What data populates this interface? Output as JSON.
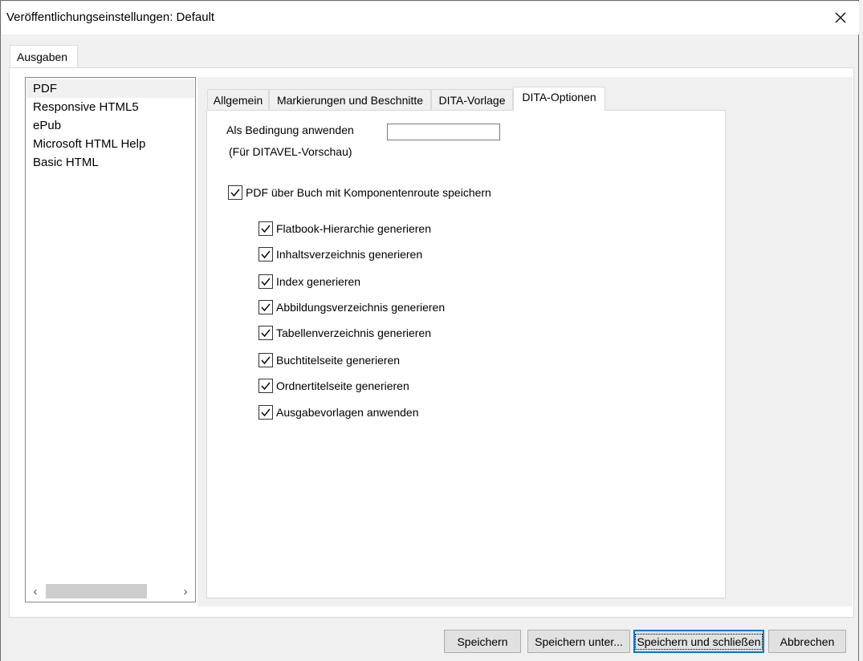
{
  "window": {
    "title": "Veröffentlichungseinstellungen: Default"
  },
  "outer_tab": {
    "label": "Ausgaben"
  },
  "outputs": {
    "items": [
      {
        "label": "PDF",
        "selected": true
      },
      {
        "label": "Responsive HTML5",
        "selected": false
      },
      {
        "label": "ePub",
        "selected": false
      },
      {
        "label": "Microsoft HTML Help",
        "selected": false
      },
      {
        "label": "Basic HTML",
        "selected": false
      }
    ],
    "scroll_left": "‹",
    "scroll_right": "›"
  },
  "tabs": [
    {
      "label": "Allgemein",
      "active": false
    },
    {
      "label": "Markierungen und Beschnitte",
      "active": false
    },
    {
      "label": "DITA-Vorlage",
      "active": false
    },
    {
      "label": "DITA-Optionen",
      "active": true
    }
  ],
  "dita_options": {
    "condition_label": "Als Bedingung anwenden",
    "condition_sublabel": "(Für DITAVEL-Vorschau)",
    "condition_value": "",
    "main_checkbox": {
      "label": "PDF über Buch mit Komponentenroute speichern",
      "checked": true
    },
    "sub_checkboxes": [
      {
        "label": "Flatbook-Hierarchie generieren",
        "checked": true
      },
      {
        "label": "Inhaltsverzeichnis generieren",
        "checked": true
      },
      {
        "label": "Index generieren",
        "checked": true
      },
      {
        "label": "Abbildungsverzeichnis generieren",
        "checked": true
      },
      {
        "label": "Tabellenverzeichnis generieren",
        "checked": true
      },
      {
        "label": "Buchtitelseite generieren",
        "checked": true
      },
      {
        "label": "Ordnertitelseite generieren",
        "checked": true
      },
      {
        "label": "Ausgabevorlagen anwenden",
        "checked": true
      }
    ]
  },
  "buttons": {
    "save": "Speichern",
    "save_as": "Speichern unter...",
    "save_close": "Speichern und schließen",
    "cancel": "Abbrechen"
  },
  "colors": {
    "accent": "#0078d7",
    "background": "#f0f0f0"
  }
}
